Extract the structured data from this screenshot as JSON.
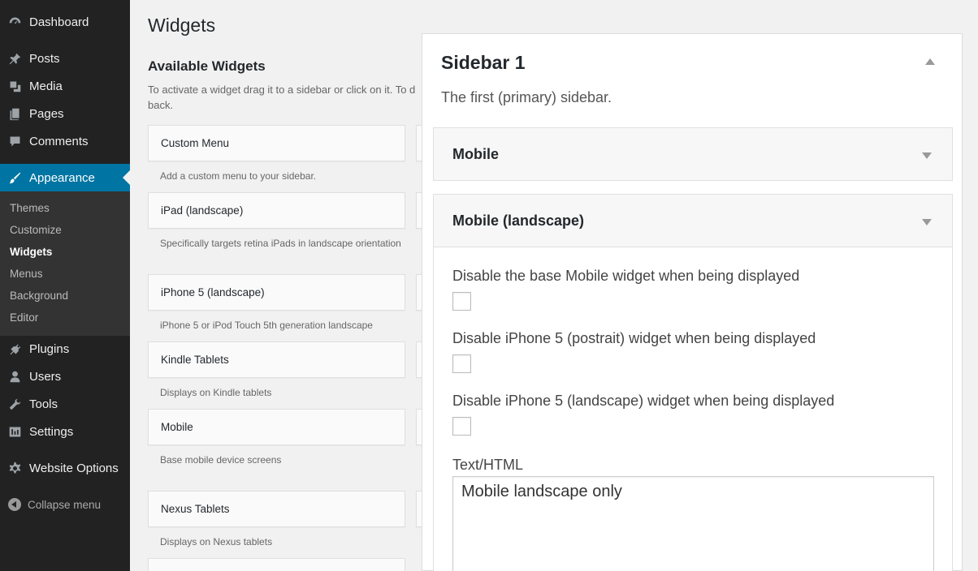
{
  "menu": {
    "items": [
      {
        "label": "Dashboard",
        "icon": "dashboard-icon"
      },
      {
        "label": "Posts",
        "icon": "pin-icon"
      },
      {
        "label": "Media",
        "icon": "media-icon"
      },
      {
        "label": "Pages",
        "icon": "pages-icon"
      },
      {
        "label": "Comments",
        "icon": "comment-icon"
      },
      {
        "label": "Appearance",
        "icon": "brush-icon"
      },
      {
        "label": "Plugins",
        "icon": "plug-icon"
      },
      {
        "label": "Users",
        "icon": "user-icon"
      },
      {
        "label": "Tools",
        "icon": "wrench-icon"
      },
      {
        "label": "Settings",
        "icon": "settings-icon"
      },
      {
        "label": "Website Options",
        "icon": "gear-icon"
      }
    ],
    "submenu": [
      "Themes",
      "Customize",
      "Widgets",
      "Menus",
      "Background",
      "Editor"
    ],
    "collapse_label": "Collapse menu",
    "accent_color": "#0074a2"
  },
  "page": {
    "title": "Widgets",
    "available_title": "Available Widgets",
    "available_desc": "To activate a widget drag it to a sidebar or click on it. To d back."
  },
  "widgets": [
    {
      "name": "Custom Menu",
      "desc": "Add a custom menu to your sidebar."
    },
    {
      "name": "iPad (landscape)",
      "desc": "Specifically targets retina iPads in landscape orientation"
    },
    {
      "name": "iPhone 5 (landscape)",
      "desc": "iPhone 5 or iPod Touch 5th generation landscape"
    },
    {
      "name": "Kindle Tablets",
      "desc": "Displays on Kindle tablets"
    },
    {
      "name": "Mobile",
      "desc": "Base mobile device screens"
    },
    {
      "name": "Nexus Tablets",
      "desc": "Displays on Nexus tablets"
    }
  ],
  "sidebar": {
    "title": "Sidebar 1",
    "desc": "The first (primary) sidebar.",
    "widgets": [
      {
        "name": "Mobile"
      },
      {
        "name": "Mobile (landscape)"
      }
    ],
    "open_widget": {
      "options": [
        {
          "label": "Disable the base Mobile widget when being displayed",
          "checked": false
        },
        {
          "label": "Disable iPhone 5 (postrait) widget when being displayed",
          "checked": false
        },
        {
          "label": "Disable iPhone 5 (landscape) widget when being displayed",
          "checked": false
        }
      ],
      "text_label": "Text/HTML",
      "text_value": "Mobile landscape only"
    }
  }
}
